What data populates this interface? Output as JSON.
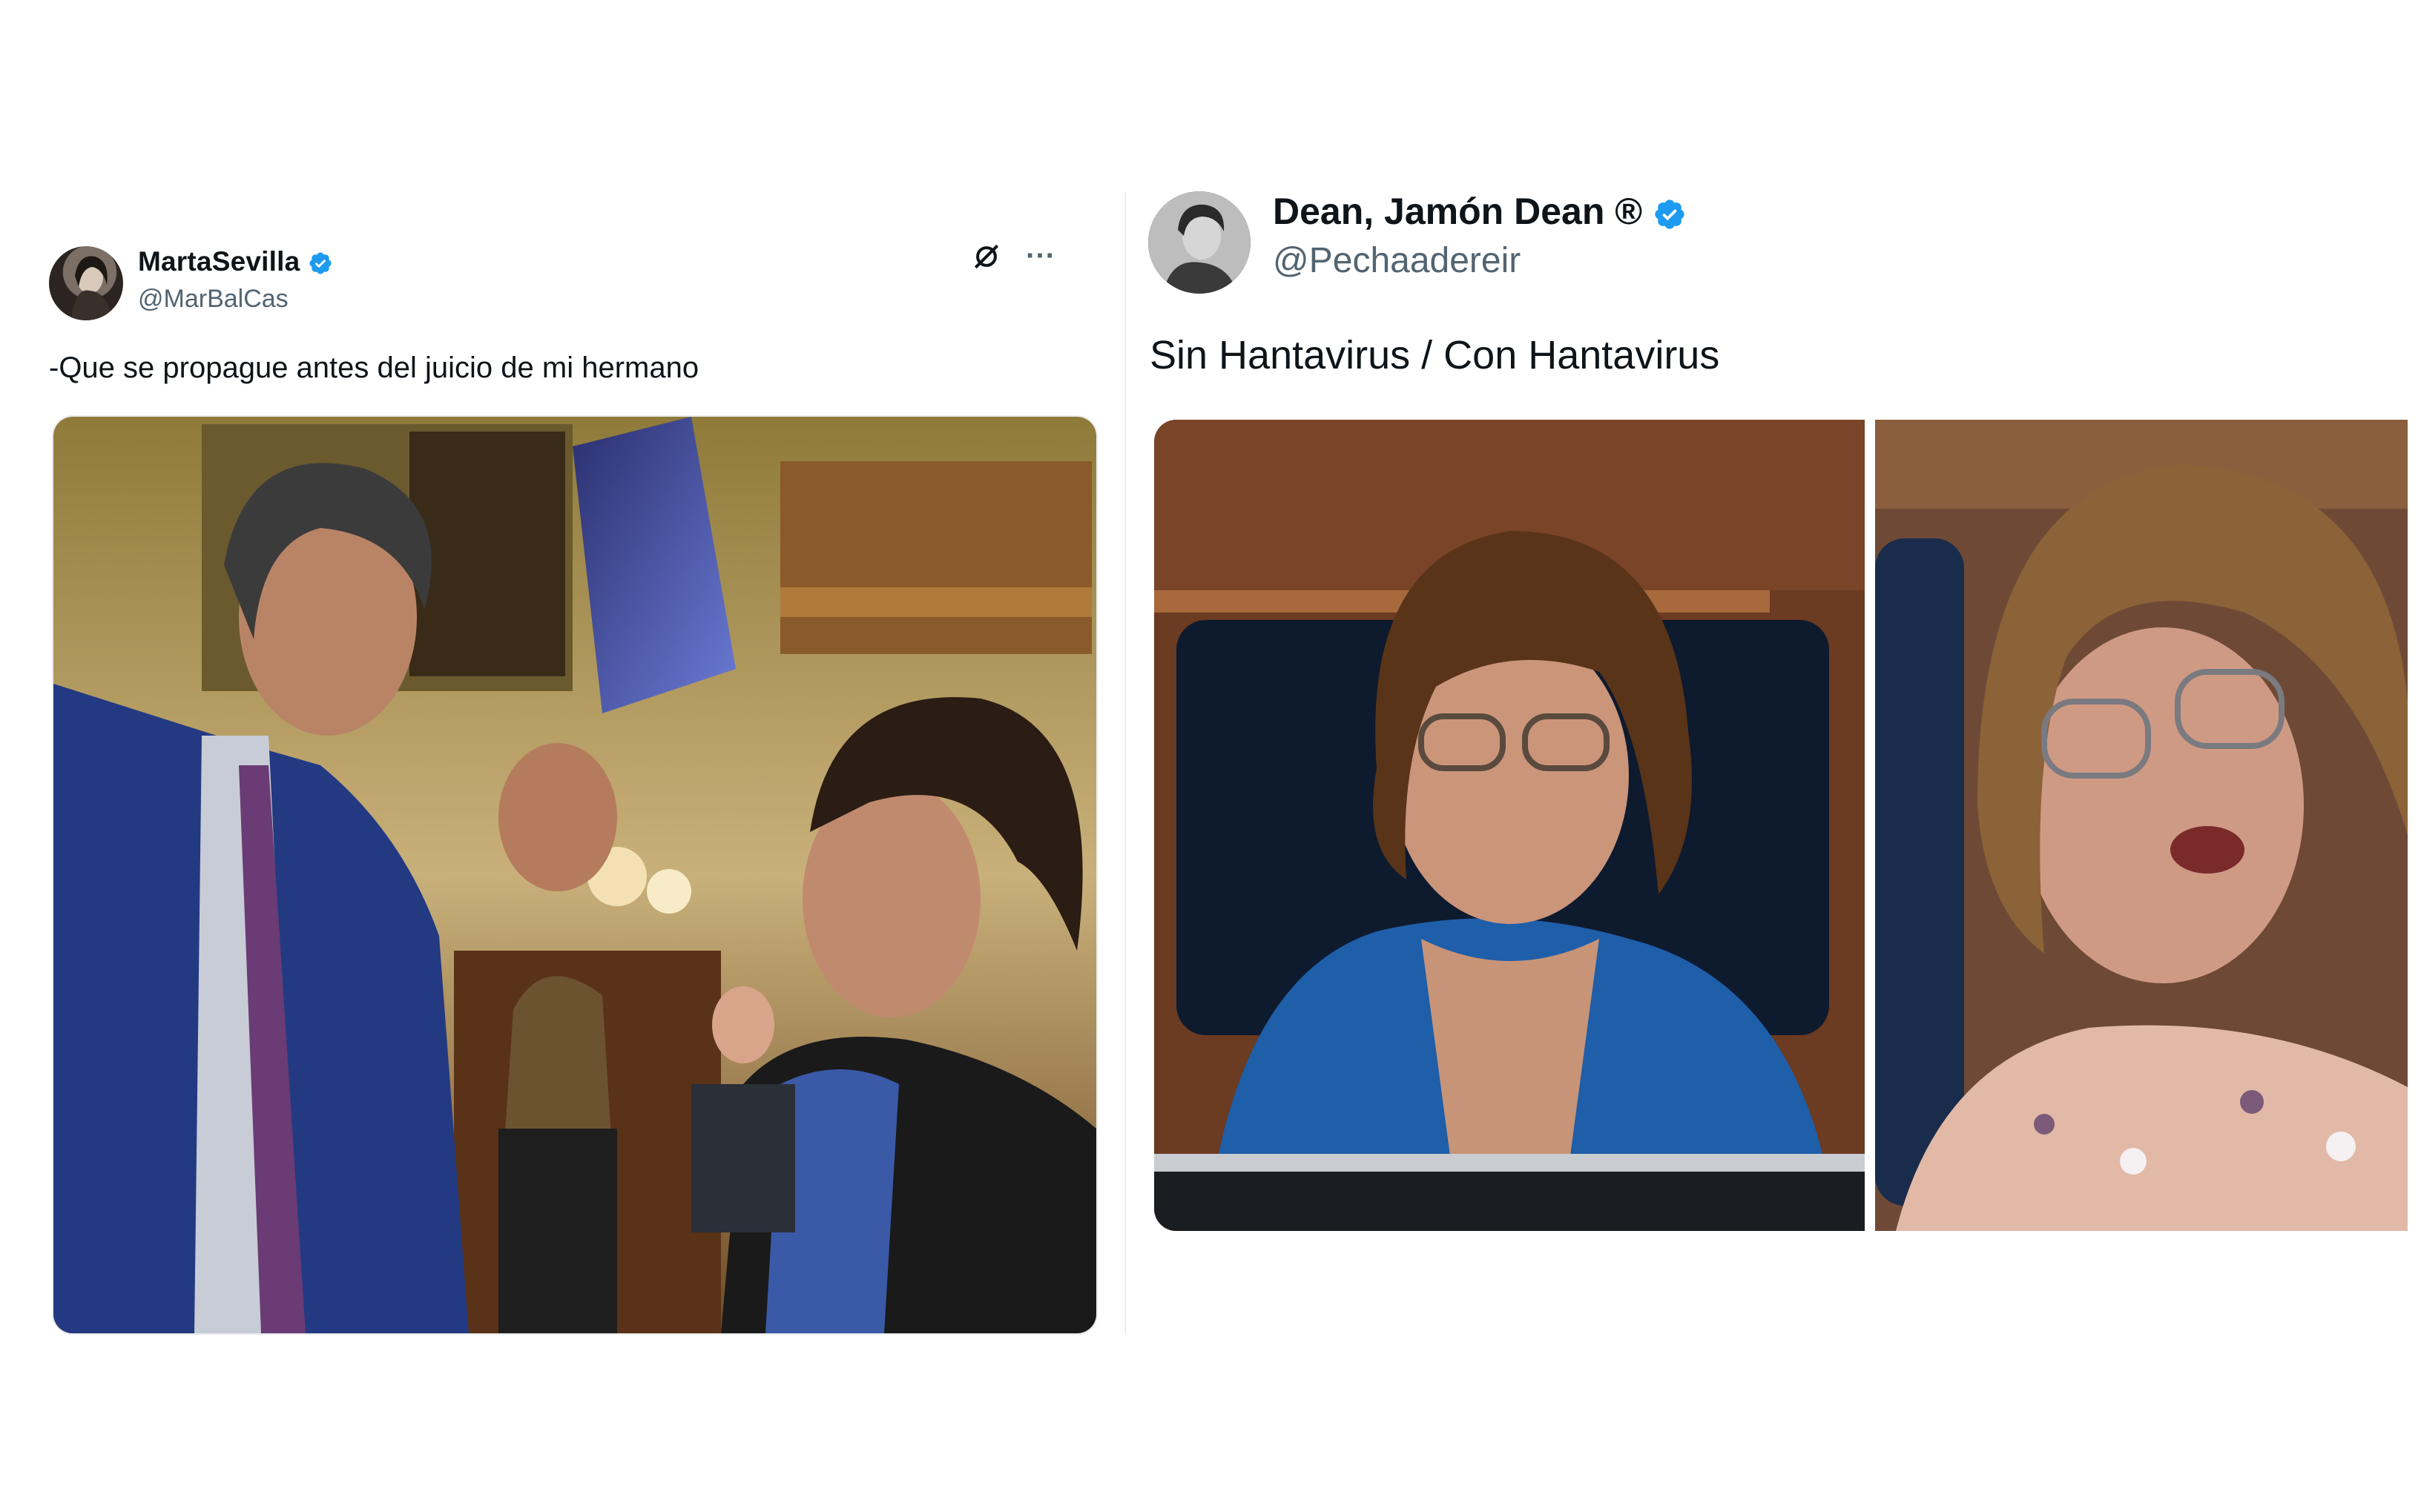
{
  "tweets": [
    {
      "display_name": "MartaSevilla",
      "handle": "@MarBalCas",
      "text": "-Que se propague antes del juicio de mi hermano",
      "verified": true,
      "icons": [
        "grok-icon",
        "more-icon"
      ],
      "more_label": "···",
      "media_description": "photo"
    },
    {
      "display_name": "Dean, Jamón Dean ®",
      "handle": "@Pechaadereir",
      "text": "Sin Hantavirus / Con Hantavirus",
      "verified": true,
      "media_description": "two-panel photo"
    }
  ],
  "colors": {
    "verified_blue": "#1d9bf0",
    "handle_gray": "#536471",
    "text": "#0f1419"
  }
}
